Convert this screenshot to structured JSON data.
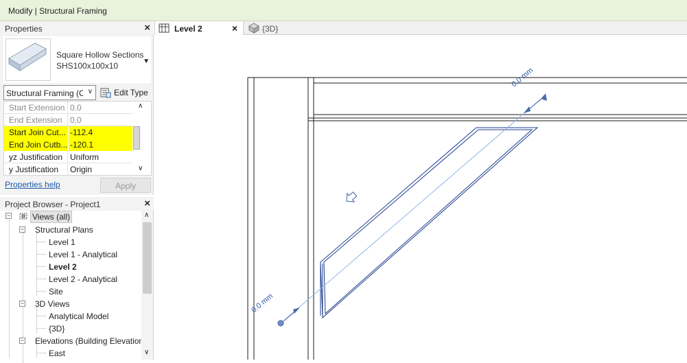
{
  "window": {
    "title": "Modify | Structural Framing"
  },
  "properties": {
    "title": "Properties",
    "type_family": "Square Hollow Sections",
    "type_name": "SHS100x100x10",
    "category_filter": "Structural Framing (C",
    "edit_type_label": "Edit Type",
    "rows": [
      {
        "key": "Start Extension",
        "value": "0.0"
      },
      {
        "key": "End Extension",
        "value": "0.0"
      },
      {
        "key": "Start Join Cut...",
        "value": "-112.4"
      },
      {
        "key": "End Join Cutb...",
        "value": "-120.1"
      },
      {
        "key": "yz Justification",
        "value": "Uniform"
      },
      {
        "key": "y Justification",
        "value": "Origin"
      }
    ],
    "help_link": "Properties help",
    "apply_label": "Apply",
    "highlight_color": "#ffff00"
  },
  "browser": {
    "title": "Project Browser - Project1",
    "root": "Views (all)",
    "structural_plans": "Structural Plans",
    "plans": [
      "Level 1",
      "Level 1 - Analytical",
      "Level 2",
      "Level 2 - Analytical",
      "Site"
    ],
    "views_3d": "3D Views",
    "views_3d_items": [
      "Analytical Model",
      "{3D}"
    ],
    "elevations": "Elevations (Building Elevation",
    "elevation_items": [
      "East"
    ],
    "tree_icons": [
      "expand-minus-icon",
      "view-group-icon"
    ]
  },
  "view_tabs": [
    {
      "label": "Level 2",
      "icon": "floor-plan-icon",
      "active": true
    },
    {
      "label": "{3D}",
      "icon": "3d-view-icon",
      "active": false
    }
  ],
  "canvas": {
    "dim_label_top": "0.0 mm",
    "dim_label_bottom": "0.0 mm",
    "line_color": "#1e3c8c",
    "analytical_color": "#8fb4e6"
  }
}
